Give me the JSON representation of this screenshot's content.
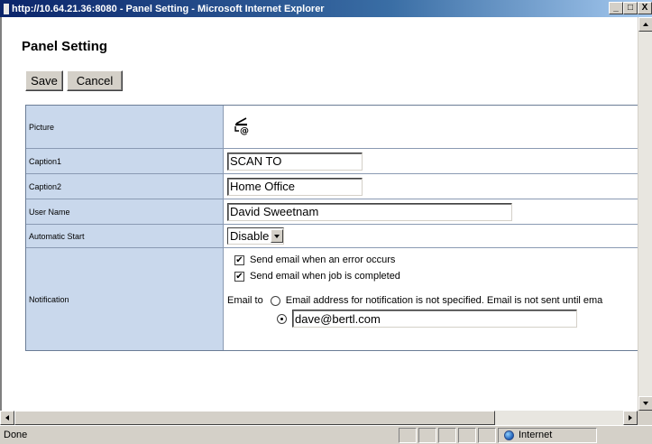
{
  "window": {
    "title": "http://10.64.21.36:8080 - Panel Setting - Microsoft Internet Explorer",
    "minimize": "_",
    "maximize": "□",
    "close": "X"
  },
  "page": {
    "title": "Panel Setting",
    "save_label": "Save",
    "cancel_label": "Cancel"
  },
  "settings": {
    "picture_label": "Picture",
    "picture_icon": "scan-to-email-icon",
    "caption1_label": "Caption1",
    "caption1_value": "SCAN TO",
    "caption2_label": "Caption2",
    "caption2_value": "Home Office",
    "username_label": "User Name",
    "username_value": "David Sweetnam",
    "autostart_label": "Automatic Start",
    "autostart_value": "Disable",
    "notification_label": "Notification",
    "notify_error_label": "Send email when an error occurs",
    "notify_error_checked": true,
    "notify_complete_label": "Send email when job is completed",
    "notify_complete_checked": true,
    "email_to_label": "Email to",
    "email_unspecified_label": "Email address for notification is not specified. Email is not sent until ema",
    "email_address_value": "dave@bertl.com",
    "selected_option": "email_address"
  },
  "statusbar": {
    "status_text": "Done",
    "zone_label": "Internet"
  }
}
